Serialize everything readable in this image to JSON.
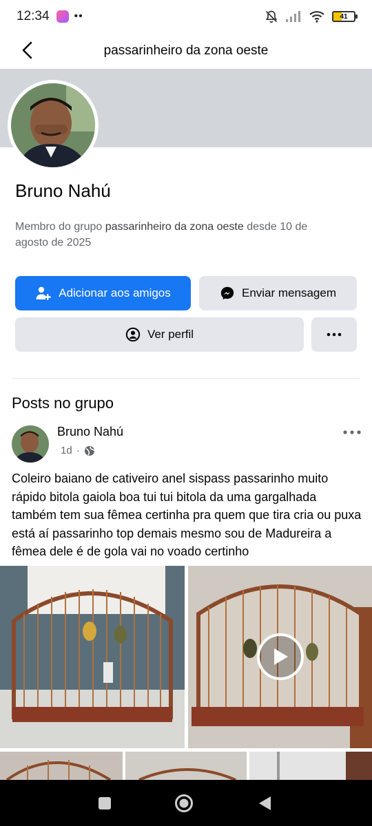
{
  "status_bar": {
    "time": "12:34",
    "battery": "41"
  },
  "header": {
    "title": "passarinheiro da zona oeste"
  },
  "profile": {
    "name": "Bruno Nahú",
    "member_prefix": "Membro do grupo ",
    "group_name": "passarinheiro da zona oeste",
    "member_suffix": " desde 10 de agosto de 2025"
  },
  "actions": {
    "add_friend": "Adicionar aos amigos",
    "send_message": "Enviar mensagem",
    "view_profile": "Ver perfil"
  },
  "posts_section": {
    "title": "Posts no grupo"
  },
  "post": {
    "author": "Bruno Nahú",
    "time": "1d",
    "separator": "·",
    "text": "Coleiro baiano de cativeiro anel sispass passarinho muito rápido bitola gaiola boa tui tui bitola da uma gargalhada também tem sua fêmea certinha pra quem que tira cria ou puxa está aí passarinho top demais mesmo sou de Madureira a fêmea dele é de gola vai no voado certinho"
  },
  "icons": {
    "back": "chevron-left-icon",
    "add_friend": "add-person-icon",
    "messenger": "messenger-icon",
    "profile": "user-circle-icon",
    "more": "more-horizontal-icon",
    "globe": "globe-icon",
    "play": "play-icon"
  },
  "colors": {
    "primary": "#1877f2",
    "secondary_bg": "#e4e6eb",
    "cover": "#d2d5da",
    "muted_text": "#65676b"
  }
}
